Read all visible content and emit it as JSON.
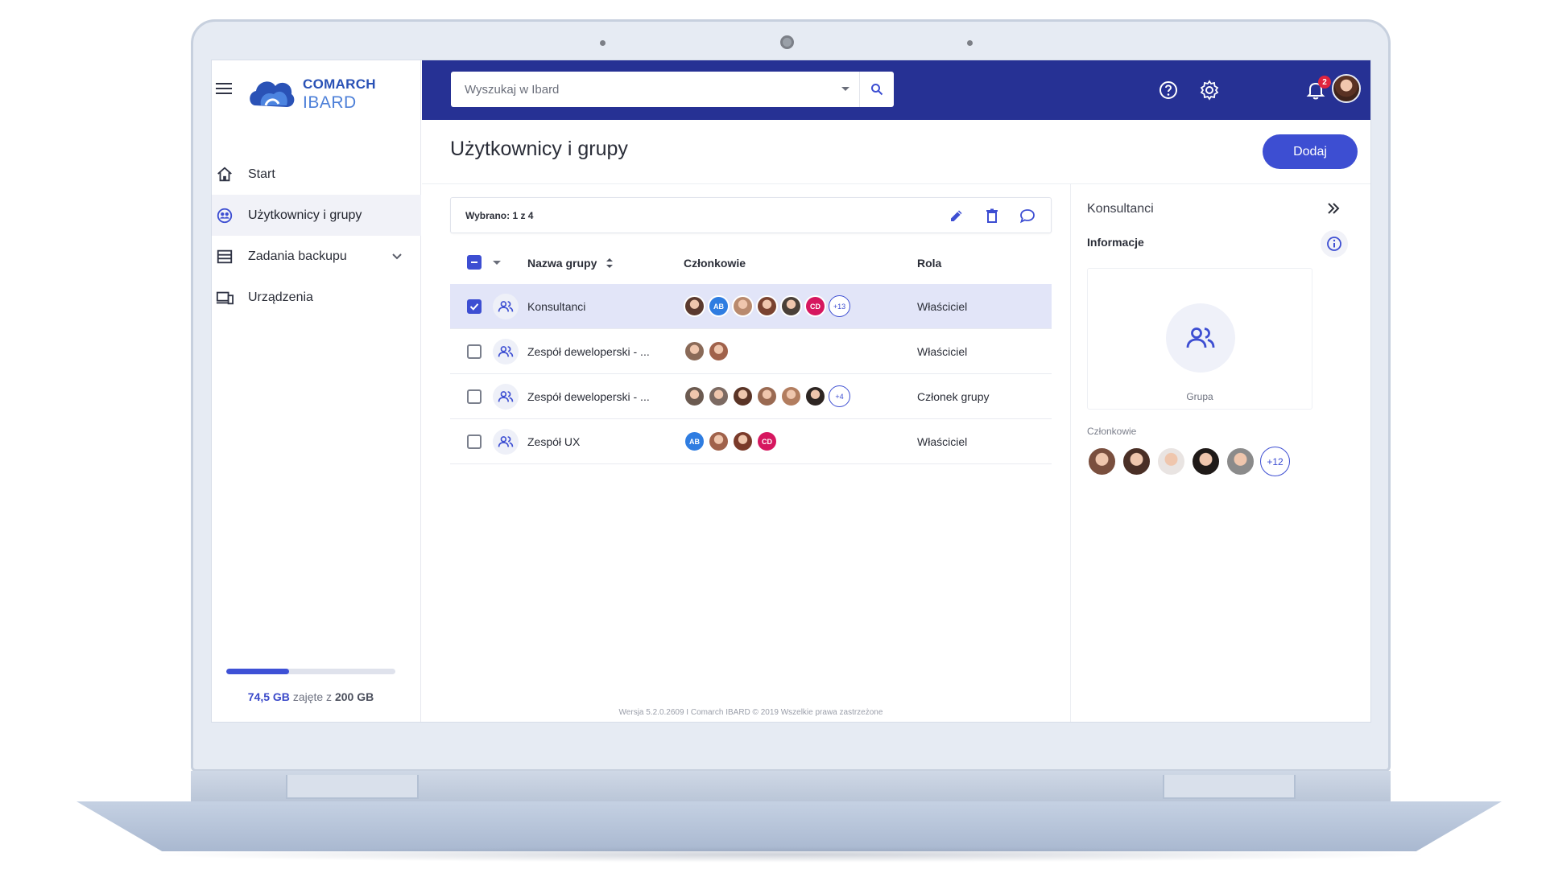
{
  "app": {
    "brand_line1": "COMARCH",
    "brand_line2": "IBARD"
  },
  "search": {
    "placeholder": "Wyszukaj w Ibard"
  },
  "header": {
    "notifications_count": "2"
  },
  "sidebar": {
    "items": [
      {
        "label": "Start",
        "icon": "home-icon"
      },
      {
        "label": "Użytkownicy i grupy",
        "icon": "users-groups-icon",
        "active": true
      },
      {
        "label": "Zadania backupu",
        "icon": "backup-tasks-icon",
        "expandable": true
      },
      {
        "label": "Urządzenia",
        "icon": "devices-icon"
      }
    ],
    "storage": {
      "used": "74,5 GB",
      "label": "zajęte z",
      "total": "200 GB",
      "used_fraction": 0.3725
    }
  },
  "page": {
    "title": "Użytkownicy i grupy",
    "add_button": "Dodaj"
  },
  "selection": {
    "text": "Wybrano: 1 z 4"
  },
  "table": {
    "headers": {
      "name": "Nazwa grupy",
      "members": "Członkowie",
      "role": "Rola"
    },
    "rows": [
      {
        "name": "Konsultanci",
        "role": "Właściciel",
        "selected": true,
        "more": "+13",
        "avatars": [
          {
            "type": "photo",
            "color": "#5b3a2e"
          },
          {
            "type": "initials",
            "text": "AB",
            "color": "#2f7de1"
          },
          {
            "type": "photo",
            "color": "#b98a6e"
          },
          {
            "type": "photo",
            "color": "#7a4330"
          },
          {
            "type": "photo",
            "color": "#4a4038"
          },
          {
            "type": "initials",
            "text": "CD",
            "color": "#d6175f"
          }
        ]
      },
      {
        "name": "Zespół deweloperski - ...",
        "role": "Właściciel",
        "selected": false,
        "more": "",
        "avatars": [
          {
            "type": "photo",
            "color": "#8a6a58"
          },
          {
            "type": "photo",
            "color": "#a0624b"
          }
        ]
      },
      {
        "name": "Zespół deweloperski - ...",
        "role": "Członek grupy",
        "selected": false,
        "more": "+4",
        "avatars": [
          {
            "type": "photo",
            "color": "#6b5a50"
          },
          {
            "type": "photo",
            "color": "#7c6a62"
          },
          {
            "type": "photo",
            "color": "#5a3426"
          },
          {
            "type": "photo",
            "color": "#9a6a52"
          },
          {
            "type": "photo",
            "color": "#b27d5f"
          },
          {
            "type": "photo",
            "color": "#2d2522"
          }
        ]
      },
      {
        "name": "Zespół UX",
        "role": "Właściciel",
        "selected": false,
        "more": "",
        "avatars": [
          {
            "type": "initials",
            "text": "AB",
            "color": "#2f7de1"
          },
          {
            "type": "photo",
            "color": "#a0624b"
          },
          {
            "type": "photo",
            "color": "#7a3a2a"
          },
          {
            "type": "initials",
            "text": "CD",
            "color": "#d6175f"
          }
        ]
      }
    ]
  },
  "footer": {
    "text": "Wersja  5.2.0.2609  I   Comarch IBARD   © 2019 Wszelkie prawa zastrzeżone"
  },
  "details": {
    "title": "Konsultanci",
    "info_label": "Informacje",
    "card_label": "Grupa",
    "members_label": "Członkowie",
    "more": "+12",
    "avatars": [
      {
        "color": "#7a4f3e"
      },
      {
        "color": "#4a2f26"
      },
      {
        "color": "#e9e4e2"
      },
      {
        "color": "#1f1a18"
      },
      {
        "color": "#8b8b8b"
      }
    ]
  },
  "colors": {
    "header_bg": "#263194",
    "accent": "#3d4ed2",
    "selected_row": "#e2e5f8",
    "badge": "#e0243e"
  }
}
